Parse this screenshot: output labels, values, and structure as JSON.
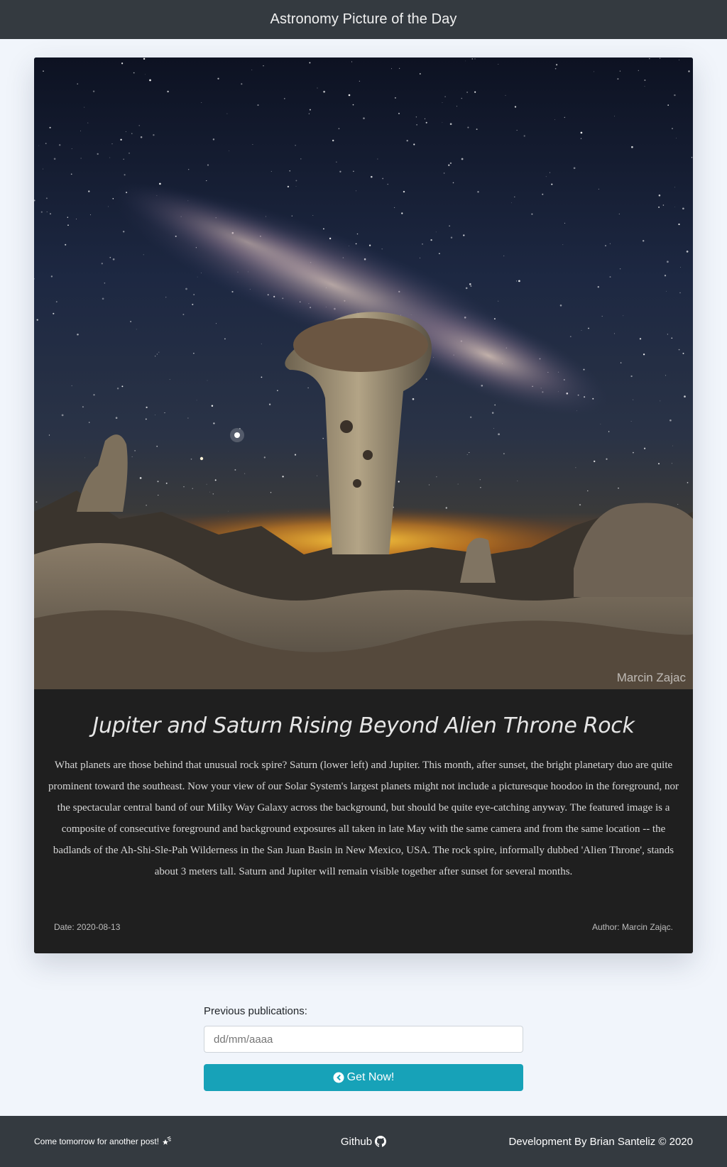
{
  "navbar": {
    "title": "Astronomy Picture of the Day"
  },
  "apod": {
    "image_watermark": "Marcin Zajac",
    "title": "Jupiter and Saturn Rising Beyond Alien Throne Rock",
    "explanation": "What planets are those behind that unusual rock spire? Saturn (lower left) and  Jupiter.  This month, after sunset, the bright planetary duo are quite prominent toward the southeast.  Now your view of our Solar System's largest planets might not include a picturesque hoodoo in the foreground, nor the spectacular central band of our Milky Way Galaxy across the background, but should be quite eye-catching anyway.  The featured image is a composite of consecutive foreground and background exposures all taken in late May with the same camera and from the same location -- the badlands of the  Ah-Shi-Sle-Pah Wilderness in the San Juan Basin in New Mexico, USA.  The rock spire, informally dubbed 'Alien Throne', stands about 3 meters tall. Saturn and  Jupiter will remain visible together after sunset for several months.",
    "date_label": "Date: 2020-08-13",
    "author_label": "Author: Marcin Zając."
  },
  "previous": {
    "label": "Previous publications:",
    "date_placeholder": "dd/mm/aaaa",
    "button_label": "Get Now!",
    "button_icon": "arrow-circle-left-icon"
  },
  "footer": {
    "left_text": "Come tomorrow for another post!",
    "left_icon": "shooting-star-icon",
    "github_label": "Github",
    "github_icon": "github-icon",
    "credit": "Development By Brian Santeliz © 2020"
  },
  "colors": {
    "navbar_bg": "#343a40",
    "page_bg": "#f1f5fb",
    "card_body_bg": "#1f1f1f",
    "button_bg": "#17a2b8",
    "footer_bg": "#343a40"
  }
}
